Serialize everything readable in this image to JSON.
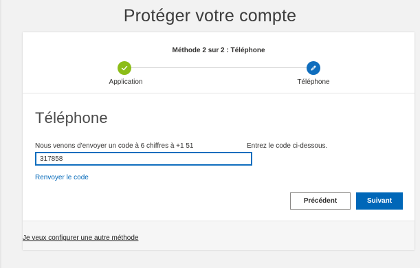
{
  "page": {
    "title": "Protéger votre compte"
  },
  "wizard": {
    "step_caption": "Méthode 2 sur 2 : Téléphone",
    "steps": [
      {
        "label": "Application",
        "state": "done",
        "icon": "check-icon"
      },
      {
        "label": "Téléphone",
        "state": "active",
        "icon": "pencil-icon"
      }
    ]
  },
  "form": {
    "section_title": "Téléphone",
    "sent_message": "Nous venons d'envoyer un code à 6 chiffres à +1 51",
    "enter_code_message": "Entrez le code ci-dessous.",
    "code_value": "317858",
    "resend_label": "Renvoyer le code"
  },
  "actions": {
    "previous_label": "Précédent",
    "next_label": "Suivant"
  },
  "footer": {
    "other_method_label": "Je veux configurer une autre méthode"
  },
  "colors": {
    "accent": "#0067b8",
    "done_step": "#8cbd18",
    "active_step": "#106ebe",
    "background": "#f2f2f2"
  }
}
